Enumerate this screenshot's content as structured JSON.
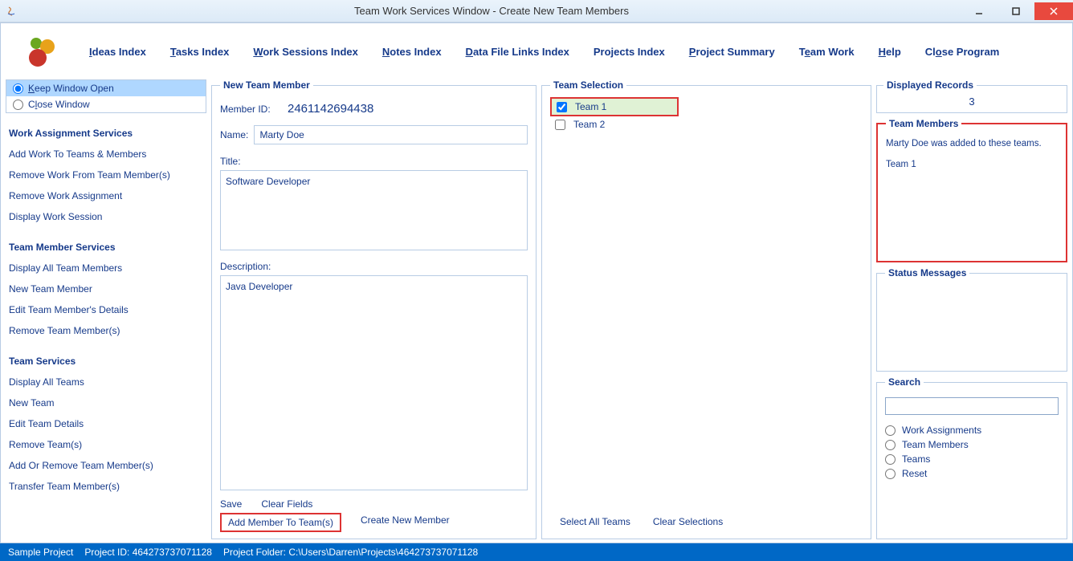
{
  "window": {
    "title": "Team Work Services Window - Create New Team Members"
  },
  "menu": {
    "ideas": "Ideas Index",
    "tasks": "Tasks Index",
    "work_sessions": "Work Sessions Index",
    "notes": "Notes Index",
    "data_file": "Data File Links Index",
    "projects": "Projects Index",
    "project_summary": "Project Summary",
    "team_work": "Team Work",
    "help": "Help",
    "close": "Close Program"
  },
  "sidebar": {
    "keep_open": "Keep Window Open",
    "close_window": "Close Window",
    "work_heading": "Work Assignment Services",
    "work": {
      "add": "Add Work To Teams & Members",
      "remove_from_member": "Remove Work From Team Member(s)",
      "remove_assignment": "Remove Work Assignment",
      "display_session": "Display Work Session"
    },
    "member_heading": "Team Member Services",
    "member": {
      "display_all": "Display All Team Members",
      "new": "New Team Member",
      "edit": "Edit Team Member's Details",
      "remove": "Remove Team Member(s)"
    },
    "team_heading": "Team Services",
    "team": {
      "display_all": "Display All Teams",
      "new": "New Team",
      "edit": "Edit Team Details",
      "remove": "Remove Team(s)",
      "add_remove_members": "Add Or Remove Team Member(s)",
      "transfer": "Transfer Team Member(s)"
    }
  },
  "new_member": {
    "legend": "New Team Member",
    "member_id_label": "Member ID:",
    "member_id": "2461142694438",
    "name_label": "Name:",
    "name": "Marty Doe",
    "title_label": "Title:",
    "title": "Software Developer",
    "desc_label": "Description:",
    "desc": "Java Developer",
    "btn_save": "Save",
    "btn_clear": "Clear Fields",
    "btn_add": "Add Member To Team(s)",
    "btn_create": "Create New Member"
  },
  "team_sel": {
    "legend": "Team Selection",
    "team1": "Team 1",
    "team2": "Team 2",
    "btn_select_all": "Select All Teams",
    "btn_clear": "Clear Selections"
  },
  "right": {
    "displayed_legend": "Displayed Records",
    "displayed_count": "3",
    "team_members_legend": "Team Members",
    "tm_msg1": "Marty Doe was added to these teams.",
    "tm_msg2": "Team 1",
    "status_legend": "Status Messages",
    "search_legend": "Search",
    "search_opts": {
      "work": "Work Assignments",
      "members": "Team Members",
      "teams": "Teams",
      "reset": "Reset"
    }
  },
  "status": {
    "project": "Sample Project",
    "project_id": "Project ID:  464273737071128",
    "folder": "Project Folder: C:\\Users\\Darren\\Projects\\464273737071128"
  }
}
